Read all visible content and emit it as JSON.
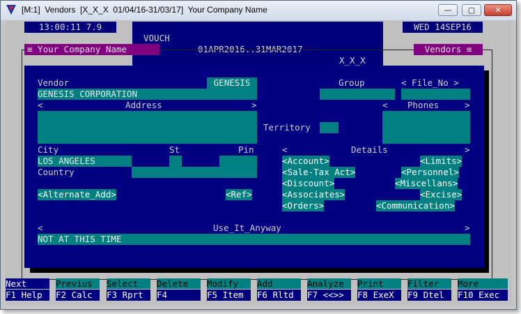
{
  "window": {
    "title": "[M:1]  Vendors  [X_X_X  01/04/16-31/03/17]  Your Company Name",
    "minimize_glyph": "—",
    "maximize_glyph": "▢",
    "close_glyph": "✕"
  },
  "status_bar": {
    "time": "13:00:11 7.9",
    "mode": "VOUCH",
    "period": "01APR2016..31MAR2017",
    "company_code": "X_X_X",
    "date": "WED 14SEP16"
  },
  "header": {
    "company": "≡ Your Company Name",
    "module": "Vendors ≡"
  },
  "form": {
    "vendor_label": "Vendor",
    "vendor_code": "GENESIS",
    "vendor_name": "GENESIS CORPORATION",
    "group_label": "Group",
    "group_value": "",
    "file_no_label": "< File_No >",
    "file_no_value": "",
    "address_left": "<",
    "address_label": "Address",
    "address_right": ">",
    "address_value": "",
    "phones_left": "<",
    "phones_label": "Phones",
    "phones_right": ">",
    "phones_value": "",
    "territory_label": "Territory",
    "territory_value": "",
    "city_label": "City",
    "city_value": "LOS ANGELES",
    "st_label": "St",
    "st_value": "",
    "pin_label": "Pin",
    "pin_value": "",
    "country_label": "Country",
    "country_value": "",
    "alternate_add": "<Alternate_Add>",
    "ref": "<Ref>",
    "details_left": "<",
    "details_label": "Details",
    "details_right": ">",
    "details_buttons": {
      "account": "<Account>",
      "limits": "<Limits>",
      "sale_tax_act": "<Sale-Tax Act>",
      "personnel": "<Personnel>",
      "discount": "<Discount>",
      "miscellans": "<Miscellans>",
      "associates": "<Associates>",
      "excise": "<Excise>",
      "orders": "<Orders>",
      "communication": "<Communication>"
    },
    "use_left": "<",
    "use_label": "Use_It_Anyway",
    "use_right": ">",
    "use_value": "NOT AT THIS TIME"
  },
  "function_keys": [
    {
      "top": "Next",
      "bottom": "F1 Help"
    },
    {
      "top": "Previus",
      "bottom": "F2 Calc"
    },
    {
      "top": "Select",
      "bottom": "F3 Rprt"
    },
    {
      "top": "Delete",
      "bottom": "F4"
    },
    {
      "top": "Modify",
      "bottom": "F5 Item"
    },
    {
      "top": "Add",
      "bottom": "F6 Rltd"
    },
    {
      "top": "Analyze",
      "bottom": "F7 <<>>"
    },
    {
      "top": "Print",
      "bottom": "F8 ExeX"
    },
    {
      "top": "Filter",
      "bottom": "F9 Dtel"
    },
    {
      "top": "More",
      "bottom": "F10 Exec"
    }
  ],
  "colors": {
    "panel": "#000080",
    "field": "#008080",
    "header_purple": "#800080",
    "screen": "#c0c0c0"
  }
}
